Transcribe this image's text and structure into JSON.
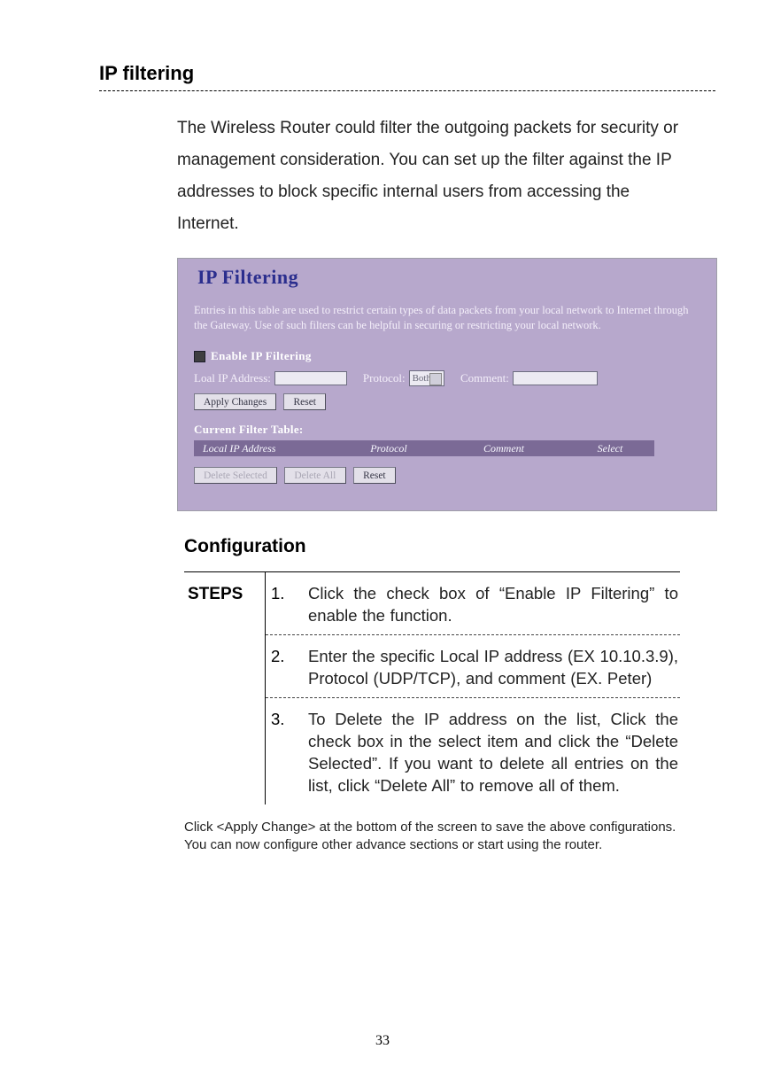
{
  "section_title": "IP filtering",
  "intro": "The Wireless Router could filter the outgoing packets for security or management consideration. You can set up the filter against the IP addresses to block specific internal users from accessing the Internet.",
  "screenshot": {
    "title": "IP Filtering",
    "description": "Entries in this table are used to restrict certain types of data packets from your local network to Internet through the Gateway. Use of such filters can be helpful in securing or restricting your local network.",
    "enable_label": "Enable IP Filtering",
    "ip_label": "Loal IP Address:",
    "protocol_label": "Protocol:",
    "protocol_value": "Both",
    "comment_label": "Comment:",
    "apply_btn": "Apply Changes",
    "reset_btn": "Reset",
    "table_title": "Current Filter Table:",
    "th_ip": "Local IP Address",
    "th_proto": "Protocol",
    "th_comment": "Comment",
    "th_select": "Select",
    "del_sel": "Delete Selected",
    "del_all": "Delete All",
    "reset2": "Reset"
  },
  "config_title": "Configuration",
  "steps_label": "STEPS",
  "steps": [
    {
      "n": "1.",
      "text": "Click the check box of “Enable IP Filtering” to enable the function."
    },
    {
      "n": "2.",
      "text": "Enter the specific Local IP address (EX 10.10.3.9), Protocol (UDP/TCP), and comment (EX. Peter)"
    },
    {
      "n": "3.",
      "text": "To Delete the IP address on the list, Click the check box in the select item and click the “Delete Selected”. If you want to delete all entries on the list, click “Delete All” to remove all of them."
    }
  ],
  "footnote": "Click <Apply Change> at the bottom of the screen to save the above configurations. You can now configure other advance sections or start using the router.",
  "page_number": "33"
}
